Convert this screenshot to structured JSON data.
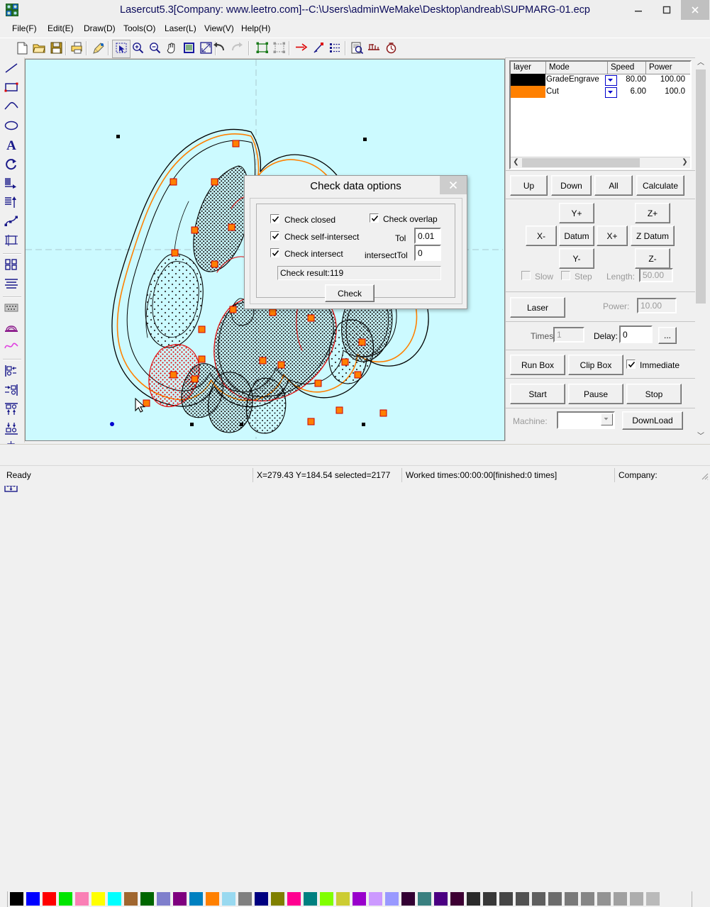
{
  "window": {
    "title": "Lasercut5.3[Company: www.leetro.com]--C:\\Users\\adminWeMake\\Desktop\\andreab\\SUPMARG-01.ecp",
    "app_icon": "lasercut-logo-icon",
    "minimize": "minimize-icon",
    "maximize": "maximize-icon",
    "close": "close-icon"
  },
  "menubar": {
    "items": [
      {
        "label": "File(F)",
        "name": "menu-file"
      },
      {
        "label": "Edit(E)",
        "name": "menu-edit"
      },
      {
        "label": "Draw(D)",
        "name": "menu-draw"
      },
      {
        "label": "Tools(O)",
        "name": "menu-tools"
      },
      {
        "label": "Laser(L)",
        "name": "menu-laser"
      },
      {
        "label": "View(V)",
        "name": "menu-view"
      },
      {
        "label": "Help(H)",
        "name": "menu-help"
      }
    ]
  },
  "toolbar": {
    "items": [
      {
        "name": "new-file-icon",
        "tip": "New"
      },
      {
        "name": "open-file-icon",
        "tip": "Open"
      },
      {
        "name": "save-file-icon",
        "tip": "Save"
      },
      {
        "name": "print-icon",
        "tip": "Print"
      },
      {
        "name": "format-painter-icon",
        "tip": "Format painter"
      },
      {
        "name": "select-tool-icon",
        "tip": "Select"
      },
      {
        "name": "zoom-in-icon",
        "tip": "Zoom in"
      },
      {
        "name": "zoom-out-icon",
        "tip": "Zoom out"
      },
      {
        "name": "pan-hand-icon",
        "tip": "Pan"
      },
      {
        "name": "zoom-page-icon",
        "tip": "Show page"
      },
      {
        "name": "zoom-selection-icon",
        "tip": "Zoom selection"
      },
      {
        "name": "undo-icon",
        "tip": "Undo"
      },
      {
        "name": "redo-icon",
        "tip": "Redo"
      },
      {
        "name": "group-icon",
        "tip": "Group"
      },
      {
        "name": "ungroup-icon",
        "tip": "Ungroup"
      },
      {
        "name": "cut-direction-icon",
        "tip": "Set cut direction"
      },
      {
        "name": "start-point-icon",
        "tip": "Set start point"
      },
      {
        "name": "cut-order-icon",
        "tip": "Cut order"
      },
      {
        "name": "preview-icon",
        "tip": "Preview"
      },
      {
        "name": "unite-lines-icon",
        "tip": "Unite lines"
      },
      {
        "name": "estimate-time-icon",
        "tip": "Estimate time"
      }
    ]
  },
  "left_toolbar": {
    "items": [
      {
        "name": "line-tool-icon",
        "tip": "Line"
      },
      {
        "name": "rectangle-tool-icon",
        "tip": "Rectangle"
      },
      {
        "name": "polyline-tool-icon",
        "tip": "Polyline"
      },
      {
        "name": "ellipse-tool-icon",
        "tip": "Ellipse"
      },
      {
        "name": "text-tool-icon",
        "tip": "Text"
      },
      {
        "name": "rotate-tool-icon",
        "tip": "Rotate"
      },
      {
        "name": "mirror-horizontal-icon",
        "tip": "Mirror horizontal"
      },
      {
        "name": "mirror-vertical-icon",
        "tip": "Mirror vertical"
      },
      {
        "name": "node-edit-icon",
        "tip": "Node edit"
      },
      {
        "name": "transform-icon",
        "tip": "Transform"
      },
      {
        "name": "array-copy-icon",
        "tip": "Array copy"
      },
      {
        "name": "align-text-icon",
        "tip": "Align"
      },
      {
        "name": "bitmap-icon",
        "tip": "Bitmap"
      },
      {
        "name": "offset-icon",
        "tip": "Offset"
      },
      {
        "name": "curve-smooth-icon",
        "tip": "Smooth curve"
      },
      {
        "name": "align-left-icon",
        "tip": "Align left"
      },
      {
        "name": "align-right-icon",
        "tip": "Align right"
      },
      {
        "name": "align-top-icon",
        "tip": "Align top"
      },
      {
        "name": "align-bottom-icon",
        "tip": "Align bottom"
      },
      {
        "name": "align-center-vertical-icon",
        "tip": "Align center vertical"
      },
      {
        "name": "align-center-horizontal-icon",
        "tip": "Align center horizontal"
      },
      {
        "name": "align-center-both-icon",
        "tip": "Center both"
      }
    ]
  },
  "canvas": {
    "background_color": "#ccfaff",
    "artwork_name": "shell-vector-artwork",
    "stroke_color": "#000000",
    "cut_layer_color": "#ff8000",
    "engrave_accent_color": "#ff0000",
    "handle_color": "#ff8000",
    "guide_color": "#b8c8cc"
  },
  "layer_panel": {
    "columns": [
      "layer",
      "Mode",
      "Speed",
      "Power"
    ],
    "rows": [
      {
        "color": "#000000",
        "mode": "GradeEngrave",
        "speed": "80.00",
        "power": "100.00"
      },
      {
        "color": "#ff8000",
        "mode": "Cut",
        "speed": "6.00",
        "power": "100.0"
      }
    ],
    "scroll_left": "scroll-left-icon",
    "scroll_right": "scroll-right-icon"
  },
  "order_buttons": [
    {
      "label": "Up",
      "name": "layer-up-button"
    },
    {
      "label": "Down",
      "name": "layer-down-button"
    },
    {
      "label": "All",
      "name": "layer-all-button"
    },
    {
      "label": "Calculate",
      "name": "calculate-button"
    }
  ],
  "jog_panel": {
    "y_plus": "Y+",
    "y_minus": "Y-",
    "x_plus": "X+",
    "x_minus": "X-",
    "datum": "Datum",
    "z_plus": "Z+",
    "z_minus": "Z-",
    "z_datum": "Z Datum",
    "slow_label": "Slow",
    "slow_checked": false,
    "step_label": "Step",
    "step_checked": false,
    "length_label": "Length:",
    "length_value": "50.00"
  },
  "laser_panel": {
    "laser_button": "Laser",
    "power_label": "Power:",
    "power_value": "10.00",
    "times_label": "Times:",
    "times_value": "1",
    "delay_label": "Delay:",
    "delay_value": "0",
    "more_button": "...",
    "run_box": "Run Box",
    "clip_box": "Clip Box",
    "immediate_label": "Immediate",
    "immediate_checked": true,
    "start": "Start",
    "pause": "Pause",
    "stop": "Stop",
    "machine_label": "Machine:",
    "machine_value": "",
    "download": "DownLoad"
  },
  "palette": {
    "colors": [
      "#000000",
      "#0000ff",
      "#ff0000",
      "#00e500",
      "#fa7fb5",
      "#ffff00",
      "#00ffff",
      "#a0662f",
      "#006600",
      "#7f7fcc",
      "#7f007f",
      "#0080c0",
      "#ff8000",
      "#99d9f0",
      "#808080",
      "#000080",
      "#808000",
      "#ff0090",
      "#008080",
      "#80ff00",
      "#cccc33",
      "#9900cc",
      "#cc99ff",
      "#9999ff",
      "#330033",
      "#3a8080",
      "#4b0082",
      "#3d0033",
      "#2b2b2b",
      "#383838",
      "#454545",
      "#525252",
      "#5f5f5f",
      "#6c6c6c",
      "#797979",
      "#868686",
      "#939393",
      "#a0a0a0",
      "#adadad",
      "#bababa"
    ]
  },
  "statusbar": {
    "ready": "Ready",
    "coords": "X=279.43 Y=184.54 selected=2177",
    "worked": "Worked times:00:00:00[finished:0 times]",
    "company": "Company:",
    "grip": "resize-grip-icon"
  },
  "dialog": {
    "title": "Check data options",
    "close": "dialog-close-icon",
    "check_closed_label": "Check closed",
    "check_closed_checked": true,
    "check_self_intersect_label": "Check self-intersect",
    "check_self_intersect_checked": true,
    "check_intersect_label": "Check intersect",
    "check_intersect_checked": true,
    "check_overlap_label": "Check overlap",
    "check_overlap_checked": true,
    "tol_label": "Tol",
    "tol_value": "0.01",
    "intersect_tol_label": "intersectTol",
    "intersect_tol_value": "0",
    "result_text": "Check result:119",
    "check_button": "Check"
  }
}
